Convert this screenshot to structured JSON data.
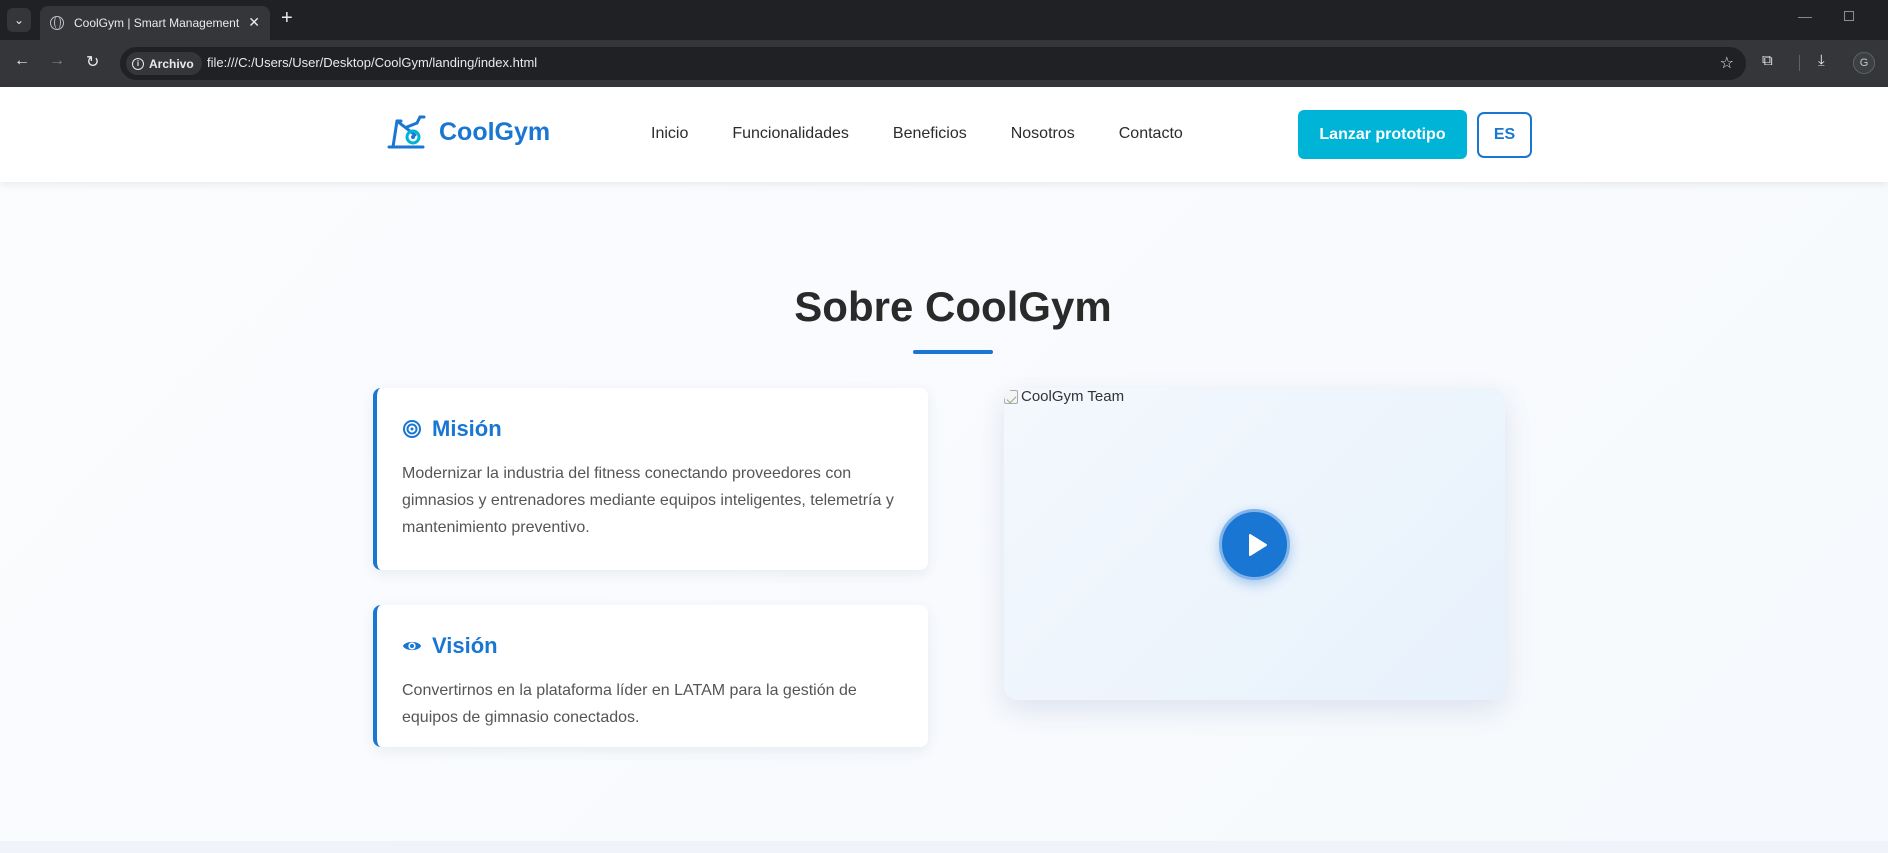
{
  "browser": {
    "tab_title": "CoolGym | Smart Management",
    "address_chip": "Archivo",
    "url": "file:///C:/Users/User/Desktop/CoolGym/landing/index.html",
    "profile_initial": "G"
  },
  "header": {
    "brand": "CoolGym",
    "nav": [
      "Inicio",
      "Funcionalidades",
      "Beneficios",
      "Nosotros",
      "Contacto"
    ],
    "cta_label": "Lanzar prototipo",
    "lang_label": "ES"
  },
  "about": {
    "title": "Sobre CoolGym",
    "mission": {
      "title": "Misión",
      "text": "Modernizar la industria del fitness conectando proveedores con gimnasios y entrenadores mediante equipos inteligentes, telemetría y mantenimiento preventivo."
    },
    "vision": {
      "title": "Visión",
      "text": "Convertirnos en la plataforma líder en LATAM para la gestión de equipos de gimnasio conectados."
    },
    "image_alt": "CoolGym Team"
  },
  "colors": {
    "brand_blue": "#1976d2",
    "cta_cyan": "#00b4d8",
    "heading": "#2a2a2a"
  }
}
